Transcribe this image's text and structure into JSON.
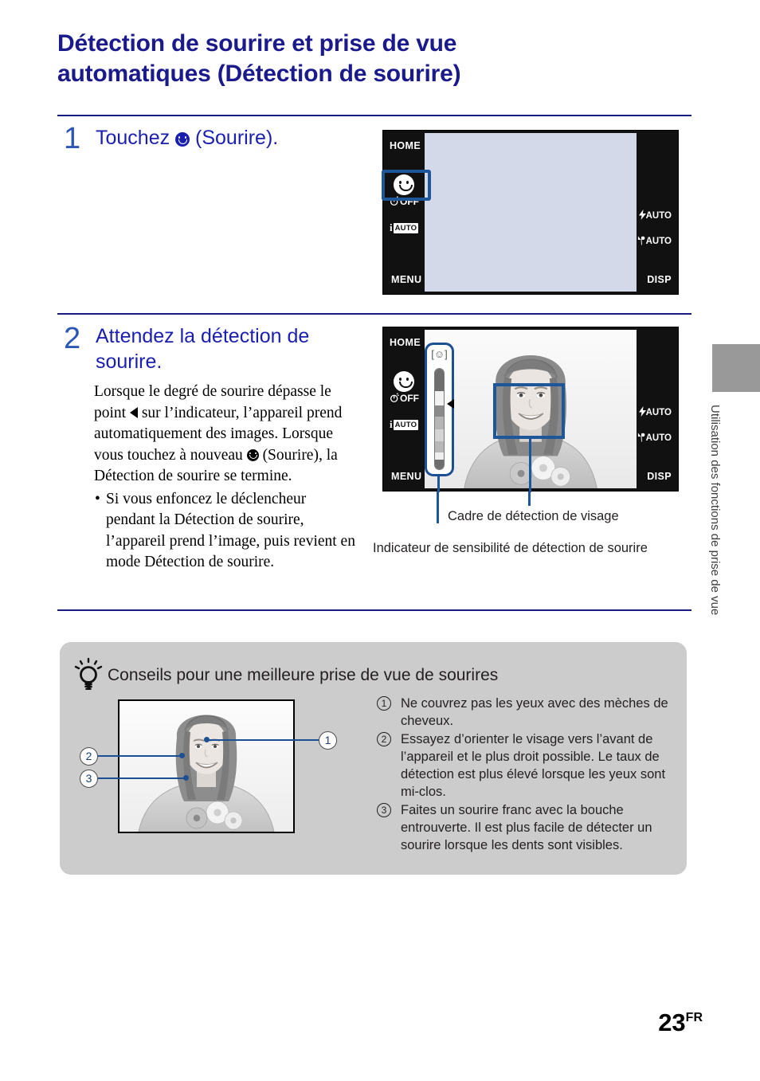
{
  "page": {
    "title": "Détection de sourire et prise de vue automatiques (Détection de sourire)",
    "title_line1": "Détection de sourire et prise de vue",
    "title_line2": "automatiques (Détection de sourire)",
    "number": "23",
    "number_suffix": "FR",
    "side_tab_text": "Utilisation des fonctions de prise de vue",
    "accent_color": "#1a1a8c",
    "rule_color": "#161b7e",
    "highlight_color": "#1d5699",
    "tips_bg_color": "#cccccc",
    "side_tab_color": "#999999"
  },
  "steps": [
    {
      "number": "1",
      "heading_before": "Touchez",
      "heading_icon": "smile-icon",
      "heading_after": "(Sourire).",
      "body": []
    },
    {
      "number": "2",
      "heading_line1": "Attendez la détection de",
      "heading_line2": "sourire.",
      "body_part1": "Lorsque le degré de sourire dépasse le point",
      "body_icon1": "triangle-left-icon",
      "body_part2": "sur l’indicateur, l’appareil prend automatiquement des images. Lorsque vous touchez à nouveau",
      "body_icon2": "smile-icon",
      "body_part3": "(Sourire), la Détection de sourire se termine.",
      "bullet": "Si vous enfoncez le déclencheur pendant la Détection de sourire, l’appareil prend l’image, puis revient en mode Détection de sourire."
    }
  ],
  "lcd_screen_1": {
    "home_label": "HOME",
    "menu_label": "MENU",
    "disp_label": "DISP",
    "smile_button": "smile-icon",
    "selftimer_label": "OFF",
    "iauto_label": "AUTO",
    "flash_label": "AUTO",
    "macro_label": "AUTO"
  },
  "lcd_screen_2": {
    "home_label": "HOME",
    "menu_label": "MENU",
    "disp_label": "DISP",
    "smile_button": "smile-icon",
    "selftimer_label": "OFF",
    "iauto_label": "AUTO",
    "flash_label": "AUTO",
    "macro_label": "AUTO",
    "meter_bracket": "[☺]"
  },
  "captions": {
    "face_frame": "Cadre de détection de visage",
    "sensitivity_indicator": "Indicateur de sensibilité de détection de sourire"
  },
  "tips": {
    "title": "Conseils pour une meilleure prise de vue de sourires",
    "icon": "lightbulb-icon",
    "items": [
      {
        "num": "1",
        "text": "Ne couvrez pas les yeux avec des mèches de cheveux."
      },
      {
        "num": "2",
        "text": "Essayez d’orienter le visage vers l’avant de l’appareil et le plus droit possible. Le taux de détection est plus élevé lorsque les yeux sont mi-clos."
      },
      {
        "num": "3",
        "text": "Faites un sourire franc avec la bouche entrouverte. Il est plus facile de détecter un sourire lorsque les dents sont visibles."
      }
    ],
    "callouts": [
      {
        "label": "1"
      },
      {
        "label": "2"
      },
      {
        "label": "3"
      }
    ]
  }
}
